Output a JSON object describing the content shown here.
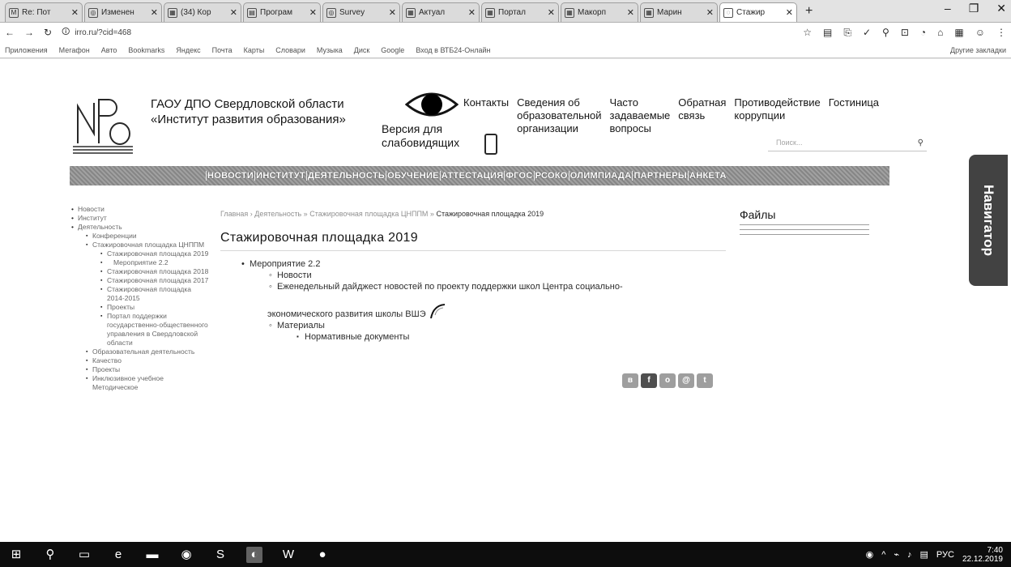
{
  "browser": {
    "tabs": [
      {
        "icon": "M",
        "label": "Re: Пот"
      },
      {
        "icon": "◎",
        "label": "Изменен"
      },
      {
        "icon": "▦",
        "label": "(34) Кор"
      },
      {
        "icon": "▤",
        "label": "Програм"
      },
      {
        "icon": "◎",
        "label": "Survey"
      },
      {
        "icon": "▦",
        "label": "Актуал"
      },
      {
        "icon": "▦",
        "label": "Портал"
      },
      {
        "icon": "▦",
        "label": "Макорп"
      },
      {
        "icon": "▦",
        "label": "Марин"
      },
      {
        "icon": "◌",
        "label": "Стажир"
      }
    ],
    "url": "irro.ru/?cid=468",
    "bookmarks": [
      "Приложения",
      "Мегафон",
      "Авто",
      "Bookmarks",
      "Яндекс",
      "Почта",
      "Карты",
      "Словари",
      "Музыка",
      "Диск",
      "Google",
      "Вход в ВТБ24-Онлайн"
    ],
    "bookmarks_right": "Другие закладки"
  },
  "site": {
    "org_line1": "ГАОУ ДПО Свердловской области",
    "org_line2": "«Институт развития образования»",
    "accessibility_line1": "Версия для",
    "accessibility_line2": "слабовидящих",
    "topnav": [
      "Контакты",
      "Сведения об\nобразовательной\nорганизации",
      "Часто\nзадаваемые\nвопросы",
      "Обратная\nсвязь",
      "Противодействие\nкоррупции",
      "Гостиница"
    ],
    "search_placeholder": "Поиск...",
    "main_menu": [
      "НОВОСТИ",
      "ИНСТИТУТ",
      "ДЕЯТЕЛЬНОСТЬ",
      "ОБУЧЕНИЕ",
      "АТТЕСТАЦИЯ",
      "ФГОС",
      "РСОКО",
      "ОЛИМПИАДА",
      "ПАРТНЕРЫ",
      "АНКЕТА"
    ],
    "navigator": "Навигатор"
  },
  "leftnav": {
    "items": [
      "Новости",
      "Институт",
      "Деятельность"
    ],
    "sub": [
      "Конференции",
      "Стажировочная площадка ЦНППМ"
    ],
    "sub2": [
      "Стажировочная площадка 2019",
      "Мероприятие 2.2",
      "Стажировочная площадка 2018",
      "Стажировочная площадка 2017",
      "Стажировочная площадка 2014-2015",
      "Проекты",
      "Портал поддержки государственно-общественного управления в Свердловской области"
    ],
    "sub3": [
      "Образовательная деятельность",
      "Качество",
      "Проекты",
      "Инклюзивное учебное Методическое"
    ]
  },
  "breadcrumb": {
    "trail": "Главная › Деятельность » Стажировочная площадка ЦНППМ »",
    "current": "Стажировочная площадка 2019"
  },
  "page_title": "Стажировочная площадка 2019",
  "content": {
    "event": "Мероприятие 2.2",
    "news": "Новости",
    "digest": "Еженедельный дайджест новостей по проекту поддержки школ Центра социально-",
    "digest_cont": "экономического развития школы ВШЭ",
    "materials": "Материалы",
    "docs": "Нормативные документы"
  },
  "share_icons": [
    "vk-icon",
    "facebook-icon",
    "odnoklassniki-icon",
    "mail-icon",
    "twitter-icon"
  ],
  "sidebar": {
    "files_title": "Файлы"
  },
  "taskbar": {
    "lang": "РУС",
    "time": "7:40",
    "date": "22.12.2019"
  }
}
